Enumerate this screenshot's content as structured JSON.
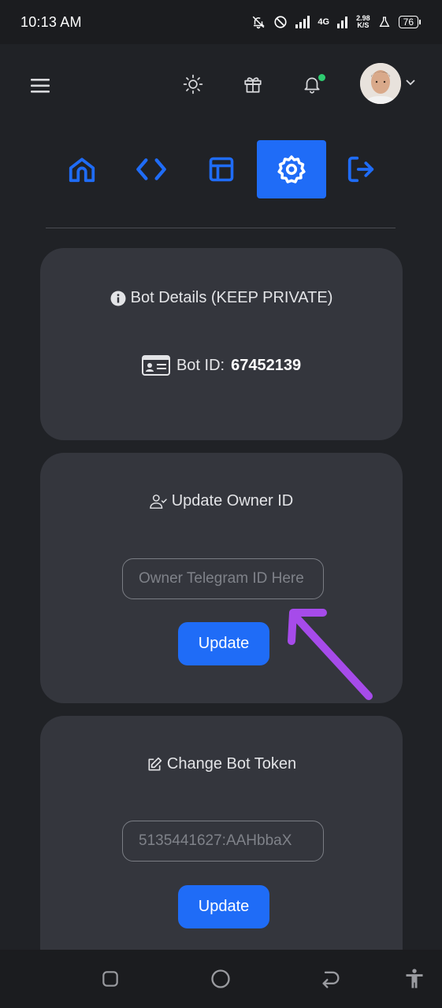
{
  "status_bar": {
    "time": "10:13 AM",
    "network": "4G",
    "speed_value": "2.98",
    "speed_unit": "K/S",
    "battery": "76"
  },
  "header": {
    "icons": [
      "menu-icon",
      "sun-icon",
      "gift-icon",
      "bell-icon",
      "avatar",
      "chevron-down-icon"
    ],
    "notification_dot_color": "#2ecc71"
  },
  "nav_tabs": {
    "items": [
      "home-icon",
      "code-icon",
      "layout-icon",
      "settings-icon",
      "logout-icon"
    ],
    "active": "settings-icon",
    "accent": "#1f6cf7"
  },
  "bot_details": {
    "title": "Bot Details (KEEP PRIVATE)",
    "bot_id_label": "Bot ID:",
    "bot_id_value": "67452139"
  },
  "owner": {
    "title": "Update Owner ID",
    "placeholder": "Owner Telegram ID Here",
    "value": "",
    "button": "Update"
  },
  "token": {
    "title": "Change Bot Token",
    "placeholder": "5135441627:AAHbbaX",
    "value": "",
    "button": "Update"
  },
  "annotation_color": "#a64bea",
  "system_nav": [
    "recents-icon",
    "home-circle-icon",
    "back-icon",
    "accessibility-icon"
  ]
}
